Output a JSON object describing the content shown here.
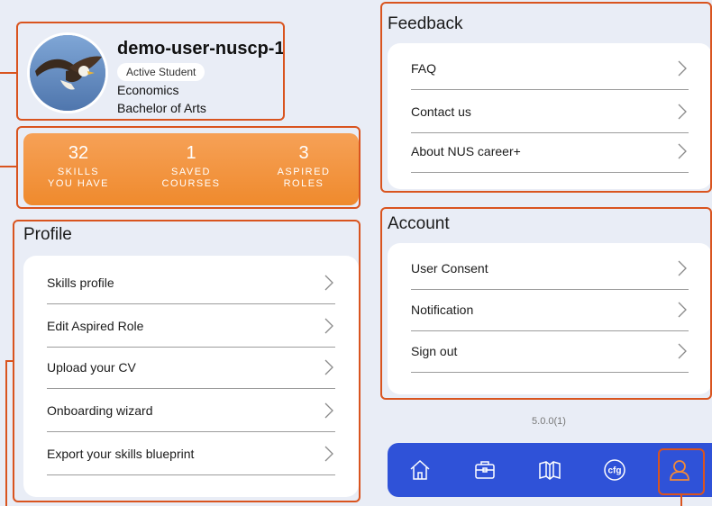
{
  "user": {
    "name": "demo-user-nuscp-1",
    "status": "Active Student",
    "major": "Economics",
    "degree": "Bachelor of Arts"
  },
  "stats": [
    {
      "value": "32",
      "label_line1": "SKILLS",
      "label_line2": "YOU HAVE"
    },
    {
      "value": "1",
      "label_line1": "SAVED",
      "label_line2": "COURSES"
    },
    {
      "value": "3",
      "label_line1": "ASPIRED",
      "label_line2": "ROLES"
    }
  ],
  "profile": {
    "title": "Profile",
    "items": [
      {
        "label": "Skills profile"
      },
      {
        "label": "Edit Aspired Role"
      },
      {
        "label": "Upload your CV"
      },
      {
        "label": "Onboarding wizard"
      },
      {
        "label": "Export your skills blueprint"
      }
    ]
  },
  "feedback": {
    "title": "Feedback",
    "items": [
      {
        "label": "FAQ"
      },
      {
        "label": "Contact us"
      },
      {
        "label": "About NUS career+"
      }
    ]
  },
  "account": {
    "title": "Account",
    "items": [
      {
        "label": "User Consent"
      },
      {
        "label": "Notification"
      },
      {
        "label": "Sign out"
      }
    ]
  },
  "version": "5.0.0(1)",
  "navbar": {
    "items": [
      {
        "icon": "home-icon"
      },
      {
        "icon": "briefcase-icon"
      },
      {
        "icon": "book-icon"
      },
      {
        "icon": "cfg-icon",
        "text": "cfg"
      },
      {
        "icon": "user-icon"
      }
    ]
  },
  "colors": {
    "accent": "#ef8a2d",
    "highlight": "#d9541f",
    "nav": "#2f52d8"
  }
}
